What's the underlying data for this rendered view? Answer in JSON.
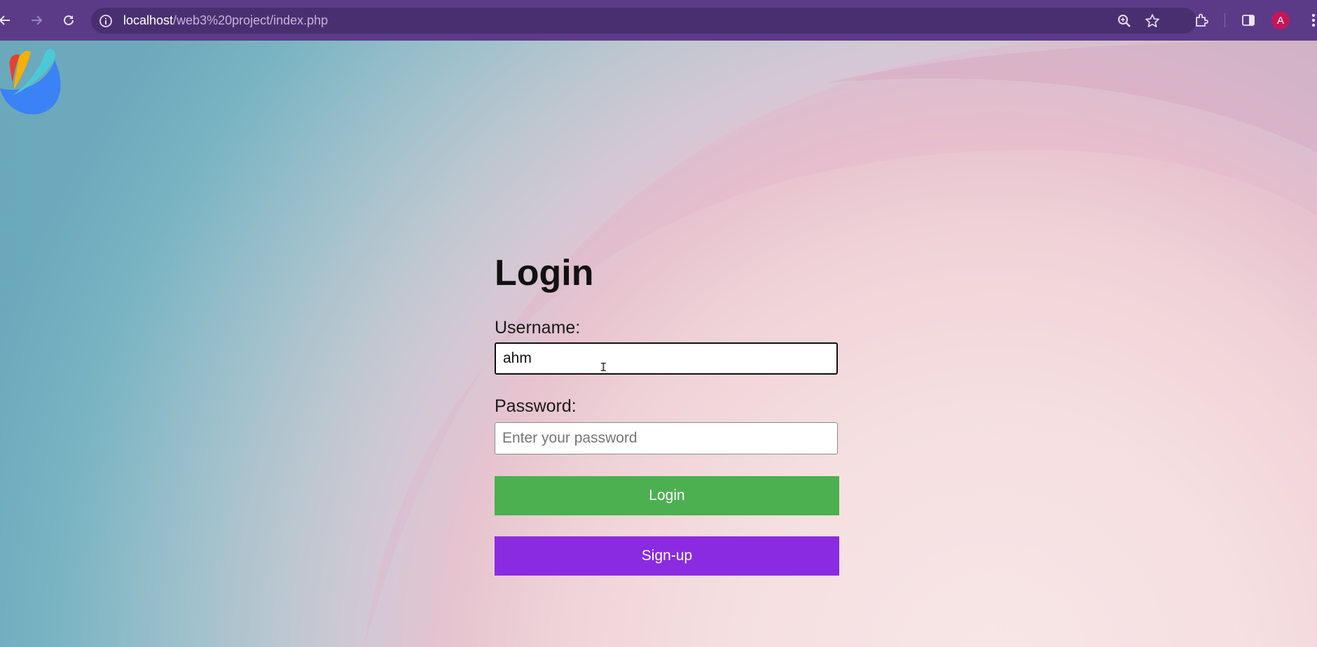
{
  "browser": {
    "url_host": "localhost",
    "url_path": "/web3%20project/index.php",
    "profile_initial": "A",
    "icons": [
      "back-icon",
      "forward-icon",
      "reload-icon",
      "site-info-icon",
      "zoom-icon",
      "bookmark-star-icon",
      "extensions-icon",
      "side-panel-icon",
      "menu-icon"
    ]
  },
  "login": {
    "title": "Login",
    "username_label": "Username:",
    "username_value": "ahm",
    "password_label": "Password:",
    "password_placeholder": "Enter your password",
    "login_button": "Login",
    "signup_button": "Sign-up"
  },
  "colors": {
    "chrome": "#5b3b87",
    "login_button": "#4caf50",
    "signup_button": "#8a2be2",
    "avatar": "#c2185b"
  }
}
